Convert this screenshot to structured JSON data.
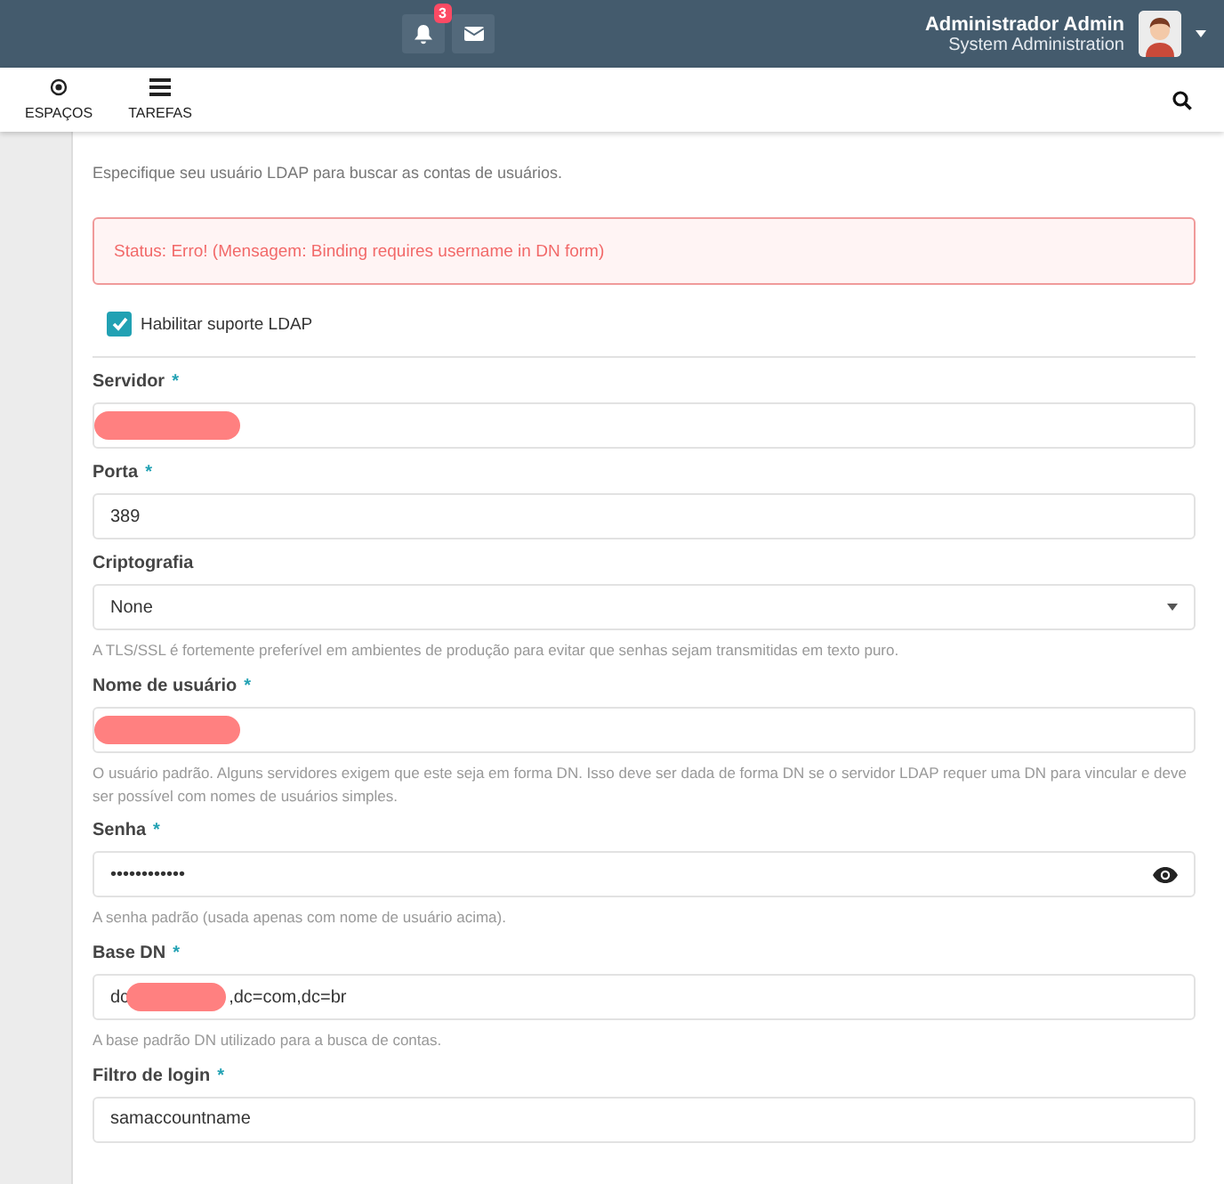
{
  "topbar": {
    "notification_count": "3",
    "user_name": "Administrador Admin",
    "user_role": "System Administration"
  },
  "nav": [
    {
      "label": "ESPAÇOS",
      "kind": "target"
    },
    {
      "label": "TAREFAS",
      "kind": "list"
    }
  ],
  "form": {
    "intro": "Especifique seu usuário LDAP para buscar as contas de usuários.",
    "alert": "Status: Erro! (Mensagem: Binding requires username in DN form)",
    "enable": {
      "label": "Habilitar suporte LDAP",
      "checked": true
    },
    "fields": [
      {
        "label": "Servidor",
        "required_mark": "*",
        "kind": "text",
        "redacted": true
      },
      {
        "label": "Porta",
        "required_mark": "*",
        "kind": "text",
        "value": "389"
      },
      {
        "label": "Criptografia",
        "kind": "select",
        "value": "None",
        "help": "A TLS/SSL é fortemente preferível em ambientes de produção para evitar que senhas sejam transmitidas em texto puro."
      },
      {
        "label": "Nome de usuário",
        "required_mark": "*",
        "kind": "text",
        "redacted": true,
        "help": "O usuário padrão. Alguns servidores exigem que este seja em forma DN. Isso deve ser dada de forma DN se o servidor LDAP requer uma DN para vincular e deve ser possível com nomes de usuários simples."
      },
      {
        "label": "Senha",
        "required_mark": "*",
        "kind": "password",
        "value": "••••••••••••",
        "help": "A senha padrão (usada apenas com nome de usuário acima)."
      },
      {
        "label": "Base DN",
        "required_mark": "*",
        "kind": "text",
        "value": "dc",
        "redacted": true,
        "value_after": ",dc=com,dc=br",
        "help": "A base padrão DN utilizado para a busca de contas."
      },
      {
        "label": "Filtro de login",
        "required_mark": "*",
        "kind": "text",
        "value": "samaccountname"
      }
    ]
  }
}
